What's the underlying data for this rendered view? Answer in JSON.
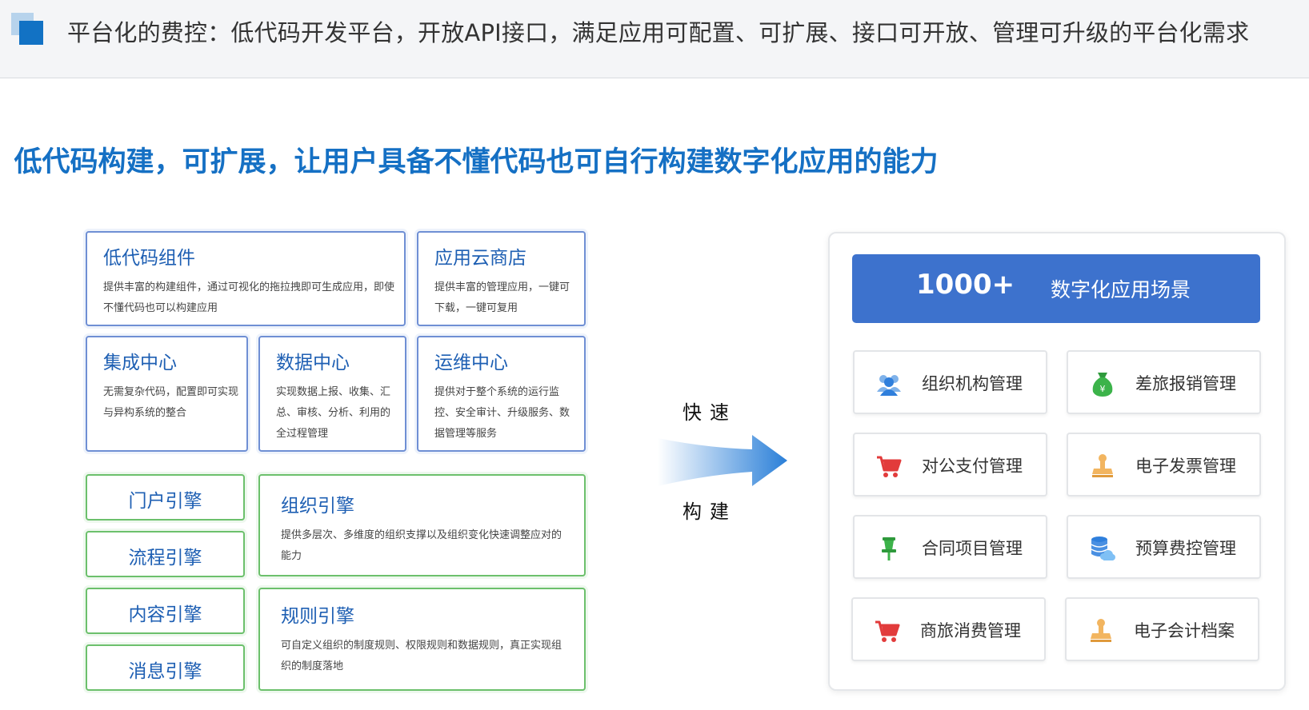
{
  "header": {
    "title": "平台化的费控：低代码开发平台，开放API接口，满足应用可配置、可扩展、接口可开放、管理可升级的平台化需求"
  },
  "headline": "低代码构建，可扩展，让用户具备不懂代码也可自行构建数字化应用的能力",
  "modules": {
    "lowcode": {
      "title": "低代码组件",
      "desc": "提供丰富的构建组件，通过可视化的拖拉拽即可生成应用，即使不懂代码也可以构建应用"
    },
    "appstore": {
      "title": "应用云商店",
      "desc": "提供丰富的管理应用，一键可下载，一键可复用"
    },
    "integration": {
      "title": "集成中心",
      "desc": "无需复杂代码，配置即可实现与异构系统的整合"
    },
    "data": {
      "title": "数据中心",
      "desc": "实现数据上报、收集、汇总、审核、分析、利用的全过程管理"
    },
    "ops": {
      "title": "运维中心",
      "desc": "提供对于整个系统的运行监控、安全审计、升级服务、数据管理等服务"
    },
    "portal": {
      "title": "门户引擎"
    },
    "process": {
      "title": "流程引擎"
    },
    "content": {
      "title": "内容引擎"
    },
    "message": {
      "title": "消息引擎"
    },
    "org": {
      "title": "组织引擎",
      "desc": "提供多层次、多维度的组织支撑以及组织变化快速调整应对的能力"
    },
    "rule": {
      "title": "规则引擎",
      "desc": "可自定义组织的制度规则、权限规则和数据规则，真正实现组织的制度落地"
    }
  },
  "arrow": {
    "top_label": "快速",
    "bottom_label": "构建",
    "color": "#2a7fd8"
  },
  "banner": {
    "count": "1000+",
    "label": "数字化应用场景",
    "color": "#3d72cd"
  },
  "scenarios": [
    {
      "label": "组织机构管理",
      "icon": "people-icon"
    },
    {
      "label": "差旅报销管理",
      "icon": "money-bag-icon"
    },
    {
      "label": "对公支付管理",
      "icon": "shopping-cart-icon"
    },
    {
      "label": "电子发票管理",
      "icon": "stamp-icon"
    },
    {
      "label": "合同项目管理",
      "icon": "pin-icon"
    },
    {
      "label": "预算费控管理",
      "icon": "database-cloud-icon"
    },
    {
      "label": "商旅消费管理",
      "icon": "shopping-cart-icon"
    },
    {
      "label": "电子会计档案",
      "icon": "stamp-icon"
    }
  ]
}
